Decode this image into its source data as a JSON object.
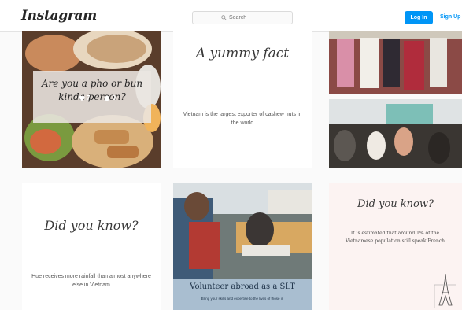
{
  "header": {
    "logo": "Instagram",
    "search_placeholder": "Search",
    "login_label": "Log In",
    "signup_label": "Sign Up"
  },
  "posts": [
    {
      "title": "Are you a pho or bun kinda person?",
      "likes": "7",
      "comments": "0"
    },
    {
      "title": "A yummy fact",
      "text": "Vietnam is the largest exporter of cashew nuts in the world"
    },
    {
      "description": "classroom photos"
    },
    {
      "title": "Did you know?",
      "text": "Hue receives more rainfall than almost anywhere else in Vietnam"
    },
    {
      "title": "Volunteer abroad as a SLT",
      "subtitle": "Bring your skills and expertise to the lives of those in"
    },
    {
      "title": "Did you know?",
      "text": "It is estimated that around 1% of the Vietnamese population still speak French"
    }
  ],
  "colors": {
    "accent": "#0095f6",
    "caption_band": "#a9bed0",
    "pink_bg": "#fcf3f2"
  }
}
